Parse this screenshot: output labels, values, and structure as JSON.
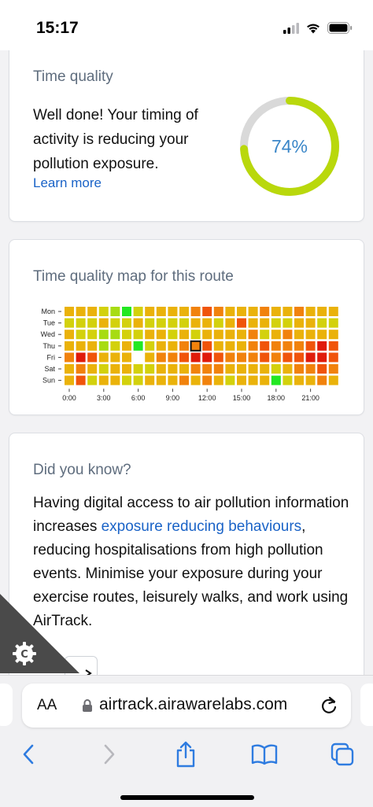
{
  "status_bar": {
    "time": "15:17",
    "signal_icon": "cellular-signal-icon",
    "wifi_icon": "wifi-icon",
    "battery_icon": "battery-icon"
  },
  "time_quality_card": {
    "title": "Time quality",
    "message": "Well done! Your timing of activity is reducing your pollution exposure.",
    "learn_more": "Learn more",
    "score_label": "74%",
    "score_fraction": 0.74,
    "ring_color": "#b9d80c",
    "ring_track_color": "#d9d9d9"
  },
  "map_card": {
    "title": "Time quality map for this route",
    "days": [
      "Mon",
      "Tue",
      "Wed",
      "Thu",
      "Fri",
      "Sat",
      "Sun"
    ],
    "time_ticks": [
      "0:00",
      "3:00",
      "6:00",
      "9:00",
      "12:00",
      "15:00",
      "18:00",
      "21:00"
    ],
    "selected_cell": {
      "day": "Thu",
      "hour": 11
    },
    "palette": [
      "#22e822",
      "#a7dc12",
      "#d3d10c",
      "#eab20a",
      "#f1820c",
      "#f0540b",
      "#e01b0b"
    ],
    "levels": [
      [
        3,
        3,
        3,
        2,
        1,
        0,
        2,
        3,
        3,
        3,
        3,
        4,
        5,
        4,
        3,
        3,
        3,
        4,
        3,
        3,
        4,
        3,
        3,
        3
      ],
      [
        2,
        2,
        2,
        3,
        2,
        2,
        3,
        2,
        2,
        2,
        2,
        3,
        3,
        2,
        3,
        5,
        3,
        3,
        2,
        2,
        3,
        3,
        2,
        2
      ],
      [
        3,
        2,
        2,
        1,
        1,
        2,
        2,
        3,
        3,
        2,
        3,
        2,
        3,
        3,
        3,
        3,
        4,
        2,
        3,
        4,
        3,
        3,
        3,
        3
      ],
      [
        3,
        3,
        3,
        1,
        2,
        3,
        0,
        2,
        3,
        3,
        4,
        4,
        5,
        3,
        3,
        3,
        4,
        5,
        4,
        4,
        4,
        5,
        6,
        5
      ],
      [
        4,
        6,
        5,
        3,
        3,
        3,
        -1,
        3,
        4,
        4,
        5,
        6,
        6,
        5,
        4,
        4,
        4,
        5,
        4,
        5,
        5,
        6,
        6,
        5
      ],
      [
        3,
        4,
        3,
        2,
        3,
        3,
        2,
        2,
        3,
        3,
        3,
        4,
        4,
        4,
        3,
        3,
        3,
        3,
        2,
        3,
        4,
        4,
        5,
        4
      ],
      [
        3,
        5,
        2,
        3,
        3,
        2,
        2,
        3,
        3,
        3,
        4,
        3,
        4,
        3,
        2,
        3,
        3,
        3,
        0,
        2,
        3,
        3,
        4,
        3
      ]
    ]
  },
  "did_you_know_card": {
    "title": "Did you know?",
    "body_before": "Having digital access to air pollution information increases ",
    "body_link": "exposure reducing behaviours",
    "body_after": ", reducing hospitalisations from high pollution events. Minimise your exposure during your exercise routes, leisurely walks, and work using AirTrack."
  },
  "browser": {
    "aa_label": "AA",
    "url": "airtrack.airawarelabs.com",
    "toolbar": [
      "back-icon",
      "forward-icon",
      "share-icon",
      "bookmarks-icon",
      "tabs-icon"
    ]
  }
}
